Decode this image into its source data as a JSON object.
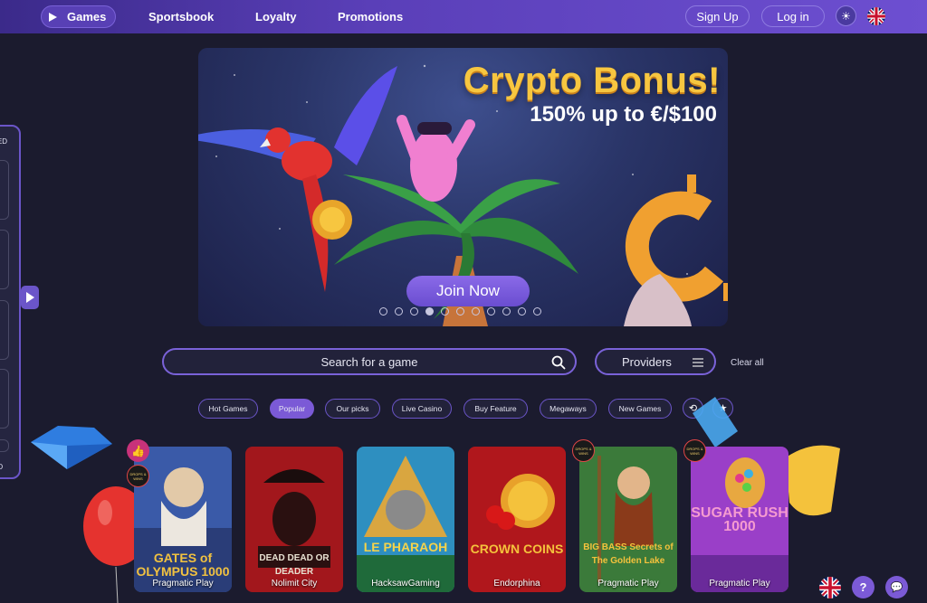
{
  "nav": {
    "games": "Games",
    "sportsbook": "Sportsbook",
    "loyalty": "Loyalty",
    "promotions": "Promotions",
    "signup": "Sign Up",
    "login": "Log in"
  },
  "banner": {
    "title": "Crypto Bonus!",
    "subtitle": "150% up to  €/$100",
    "cta": "Join Now",
    "slide_count": 11,
    "active_slide": 4
  },
  "side_panel": {
    "top_label": "TED",
    "bottom_label": "ED"
  },
  "search": {
    "placeholder": "Search for a game",
    "providers_label": "Providers",
    "clear_all": "Clear all"
  },
  "filters": [
    "Hot Games",
    "Popular",
    "Our picks",
    "Live Casino",
    "Buy Feature",
    "Megaways",
    "New Games"
  ],
  "active_filter": "Popular",
  "games": [
    {
      "title": "GATES of OLYMPUS 1000",
      "provider": "Pragmatic Play"
    },
    {
      "title": "DEAD DEAD OR DEADER",
      "provider": "Nolimit City"
    },
    {
      "title": "LE PHARAOH",
      "provider": "HacksawGaming"
    },
    {
      "title": "CROWN COINS",
      "provider": "Endorphina"
    },
    {
      "title": "BIG BASS Secrets of The Golden Lake",
      "provider": "Pragmatic Play"
    },
    {
      "title": "SUGAR RUSH 1000",
      "provider": "Pragmatic Play"
    }
  ],
  "badge_text": "DROPS & WINS",
  "colors": {
    "accent": "#7b5ad6",
    "nav_gradient_start": "#3b2a8a",
    "background": "#1b1b2e",
    "bonus_gold": "#f7c640"
  }
}
